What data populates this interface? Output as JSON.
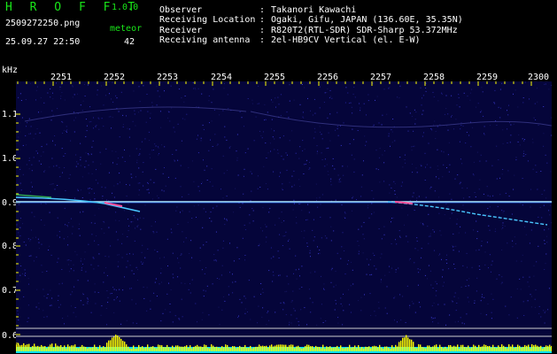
{
  "header": {
    "app_title": "H R O F F T",
    "version": "1.0.0",
    "file_name": "2509272250.png",
    "detection_label": "meteor",
    "datetime": "25.09.27 22:50",
    "detection_count": "42"
  },
  "station": {
    "rows": [
      {
        "key": "Observer",
        "value": "Takanori Kawachi"
      },
      {
        "key": "Receiving Location",
        "value": "Ogaki, Gifu, JAPAN (136.60E, 35.35N)"
      },
      {
        "key": "Receiver",
        "value": "R820T2(RTL-SDR) SDR-Sharp 53.372MHz"
      },
      {
        "key": "Receiving antenna",
        "value": "2el-HB9CV Vertical (el. E-W)"
      }
    ],
    "separator": ":"
  },
  "axes": {
    "y_unit": "kHz",
    "time_ticks": [
      "2251",
      "2252",
      "2253",
      "2254",
      "2255",
      "2256",
      "2257",
      "2258",
      "2259",
      "2300"
    ],
    "freq_ticks": [
      "1.1",
      "1.0",
      "0.9",
      "0.8",
      "0.7",
      "0.6"
    ]
  },
  "chart_data": {
    "type": "heatmap",
    "title": "",
    "xlabel": "",
    "ylabel": "kHz",
    "x": [
      "2251",
      "2252",
      "2253",
      "2254",
      "2255",
      "2256",
      "2257",
      "2258",
      "2259",
      "2300"
    ],
    "ylim": [
      0.6,
      1.15
    ],
    "carrier_khz": 0.905,
    "meteor_echo_times": [
      "2252",
      "2257.5"
    ]
  },
  "colors": {
    "background": "#000000",
    "plot_background": "#05053a",
    "title_green": "#19e619",
    "tick_yellow": "#ffff00",
    "carrier": "#b4f0ff",
    "power_bar": "#ffff00",
    "power_base": "#00e0ff"
  }
}
